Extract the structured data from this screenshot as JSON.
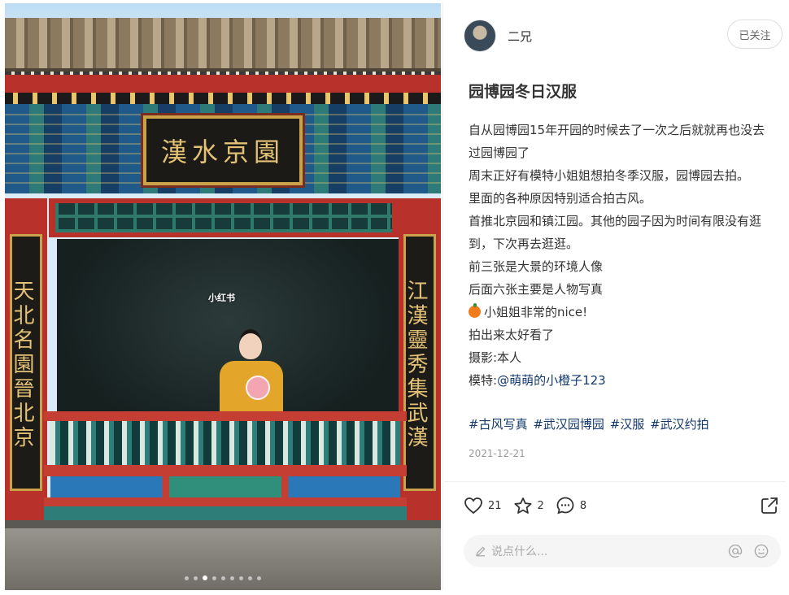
{
  "media": {
    "plaque_text": "漢水京園",
    "couplet_left": "天北名園晉北京",
    "couplet_right": "江漢靈秀集武漢",
    "watermark": "小红书",
    "dots_count": 9,
    "active_dot_index": 2
  },
  "author": {
    "name": "二兄",
    "follow_label": "已关注"
  },
  "note": {
    "title": "园博园冬日汉服",
    "lines": [
      "自从园博园15年开园的时候去了一次之后就就再也没去过园博园了",
      "周末正好有模特小姐姐想拍冬季汉服，园博园去拍。",
      "里面的各种原因特别适合拍古风。",
      "首推北京园和镇江园。其他的园子因为时间有限没有逛到，下次再去逛逛。",
      "前三张是大景的环境人像",
      "后面六张主要是人物写真",
      "小姐姐非常的nice!",
      "拍出来太好看了",
      "摄影:本人"
    ],
    "model_label": "模特:",
    "model_mention": "@萌萌的小橙子123",
    "tags": [
      "#古风写真",
      "#武汉园博园",
      "#汉服",
      "#武汉约拍"
    ],
    "date": "2021-12-21"
  },
  "stats": {
    "likes": "21",
    "collects": "2",
    "comments": "8"
  },
  "comment_box": {
    "placeholder": "说点什么..."
  },
  "icons": {
    "like": "heart-icon",
    "collect": "star-icon",
    "comment": "chat-bubble-icon",
    "share": "share-icon",
    "edit": "pencil-icon",
    "mention": "at-icon",
    "emoji": "smiley-icon"
  }
}
